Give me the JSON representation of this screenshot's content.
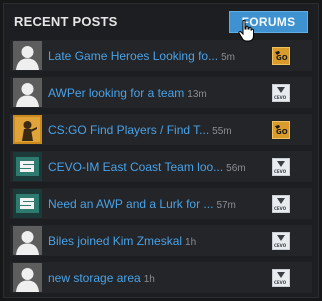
{
  "header": {
    "title": "RECENT POSTS",
    "forums_label": "FORUMS"
  },
  "posts": [
    {
      "title": "Late Game Heroes Looking fo...",
      "age": "5m",
      "avatar": "default-avatar",
      "game": "csgo",
      "game_badge": "GO"
    },
    {
      "title": "AWPer looking for a team",
      "age": "13m",
      "avatar": "default-avatar",
      "game": "cevo",
      "game_badge": "CEVO"
    },
    {
      "title": "CS:GO Find Players / Find T...",
      "age": "55m",
      "avatar": "csgo-logo-avatar",
      "game": "csgo",
      "game_badge": "GO"
    },
    {
      "title": "CEVO-IM East Coast Team loo...",
      "age": "56m",
      "avatar": "team-logo-avatar",
      "game": "cevo",
      "game_badge": "CEVO"
    },
    {
      "title": "Need an AWP and a Lurk for ...",
      "age": "57m",
      "avatar": "team-logo-avatar",
      "game": "cevo",
      "game_badge": "CEVO"
    },
    {
      "title": "Biles joined Kim Zmeskal",
      "age": "1h",
      "avatar": "default-avatar",
      "game": "cevo",
      "game_badge": "CEVO"
    },
    {
      "title": "new storage area",
      "age": "1h",
      "avatar": "default-avatar",
      "game": "cevo",
      "game_badge": "CEVO"
    }
  ]
}
